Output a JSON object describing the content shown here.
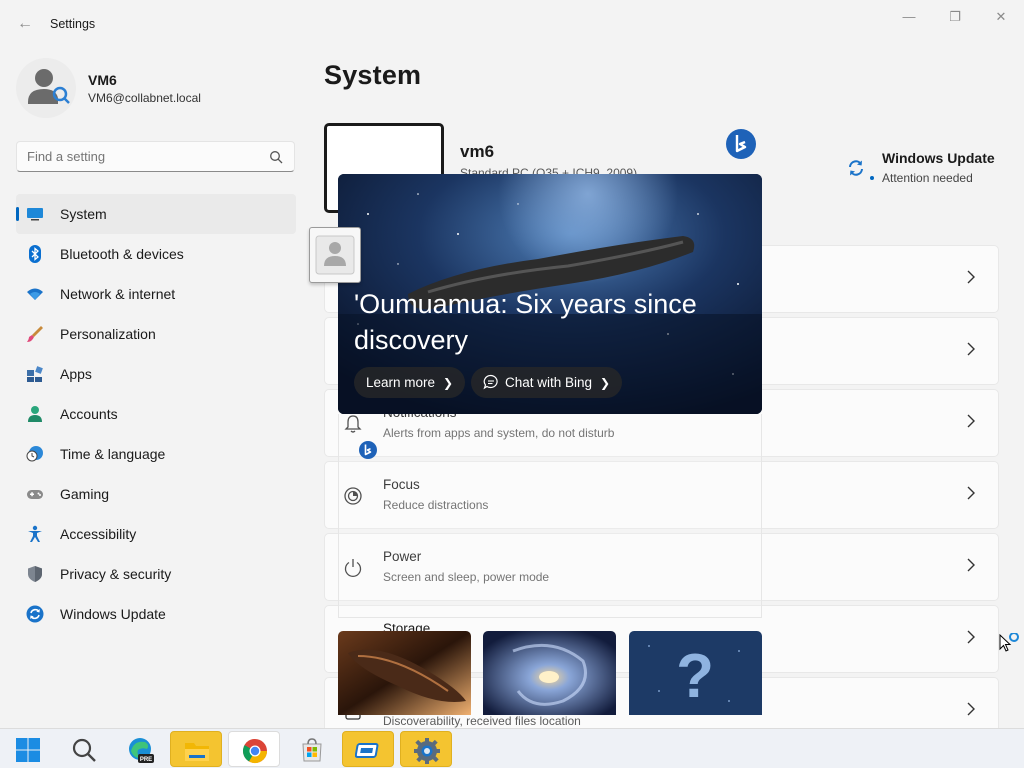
{
  "window": {
    "title": "Settings",
    "minimize": "—",
    "maximize": "❐",
    "close": "✕",
    "back": "←"
  },
  "profile": {
    "name": "VM6",
    "email": "VM6@collabnet.local"
  },
  "search": {
    "placeholder": "Find a setting"
  },
  "nav": [
    {
      "label": "System",
      "icon": "system-icon",
      "selected": true
    },
    {
      "label": "Bluetooth & devices",
      "icon": "bluetooth-icon"
    },
    {
      "label": "Network & internet",
      "icon": "wifi-icon"
    },
    {
      "label": "Personalization",
      "icon": "brush-icon"
    },
    {
      "label": "Apps",
      "icon": "apps-icon"
    },
    {
      "label": "Accounts",
      "icon": "accounts-icon"
    },
    {
      "label": "Time & language",
      "icon": "clock-globe-icon"
    },
    {
      "label": "Gaming",
      "icon": "gamepad-icon"
    },
    {
      "label": "Accessibility",
      "icon": "accessibility-icon"
    },
    {
      "label": "Privacy & security",
      "icon": "shield-icon"
    },
    {
      "label": "Windows Update",
      "icon": "update-icon"
    }
  ],
  "page": {
    "title": "System"
  },
  "device": {
    "name": "vm6",
    "model": "Standard PC (Q35 + ICH9, 2009)"
  },
  "windows_update": {
    "title": "Windows Update",
    "status": "Attention needed"
  },
  "cards": [
    {
      "title": "",
      "sub": "",
      "icon": ""
    },
    {
      "title": "",
      "sub": "",
      "icon": ""
    },
    {
      "title": "Notifications",
      "sub": "Alerts from apps and system, do not disturb",
      "icon": "bell-icon"
    },
    {
      "title": "Focus",
      "sub": "Reduce distractions",
      "icon": "focus-icon"
    },
    {
      "title": "Power",
      "sub": "Screen and sleep, power mode",
      "icon": "power-icon"
    },
    {
      "title": "Storage",
      "sub": "",
      "icon": "storage-icon"
    },
    {
      "title": "",
      "sub": "Discoverability, received files location",
      "icon": "nearby-share-icon"
    }
  ],
  "bing_flyout": {
    "title": "'Oumuamua: Six years since discovery",
    "learn_more": "Learn more",
    "chat": "Chat with Bing"
  },
  "taskbar": [
    "start-icon",
    "search-icon",
    "edge-preview-icon",
    "file-explorer-icon",
    "chrome-icon",
    "store-icon",
    "remote-desktop-icon",
    "settings-icon"
  ],
  "colors": {
    "accent": "#0067c0",
    "background": "#f3f3f3"
  }
}
